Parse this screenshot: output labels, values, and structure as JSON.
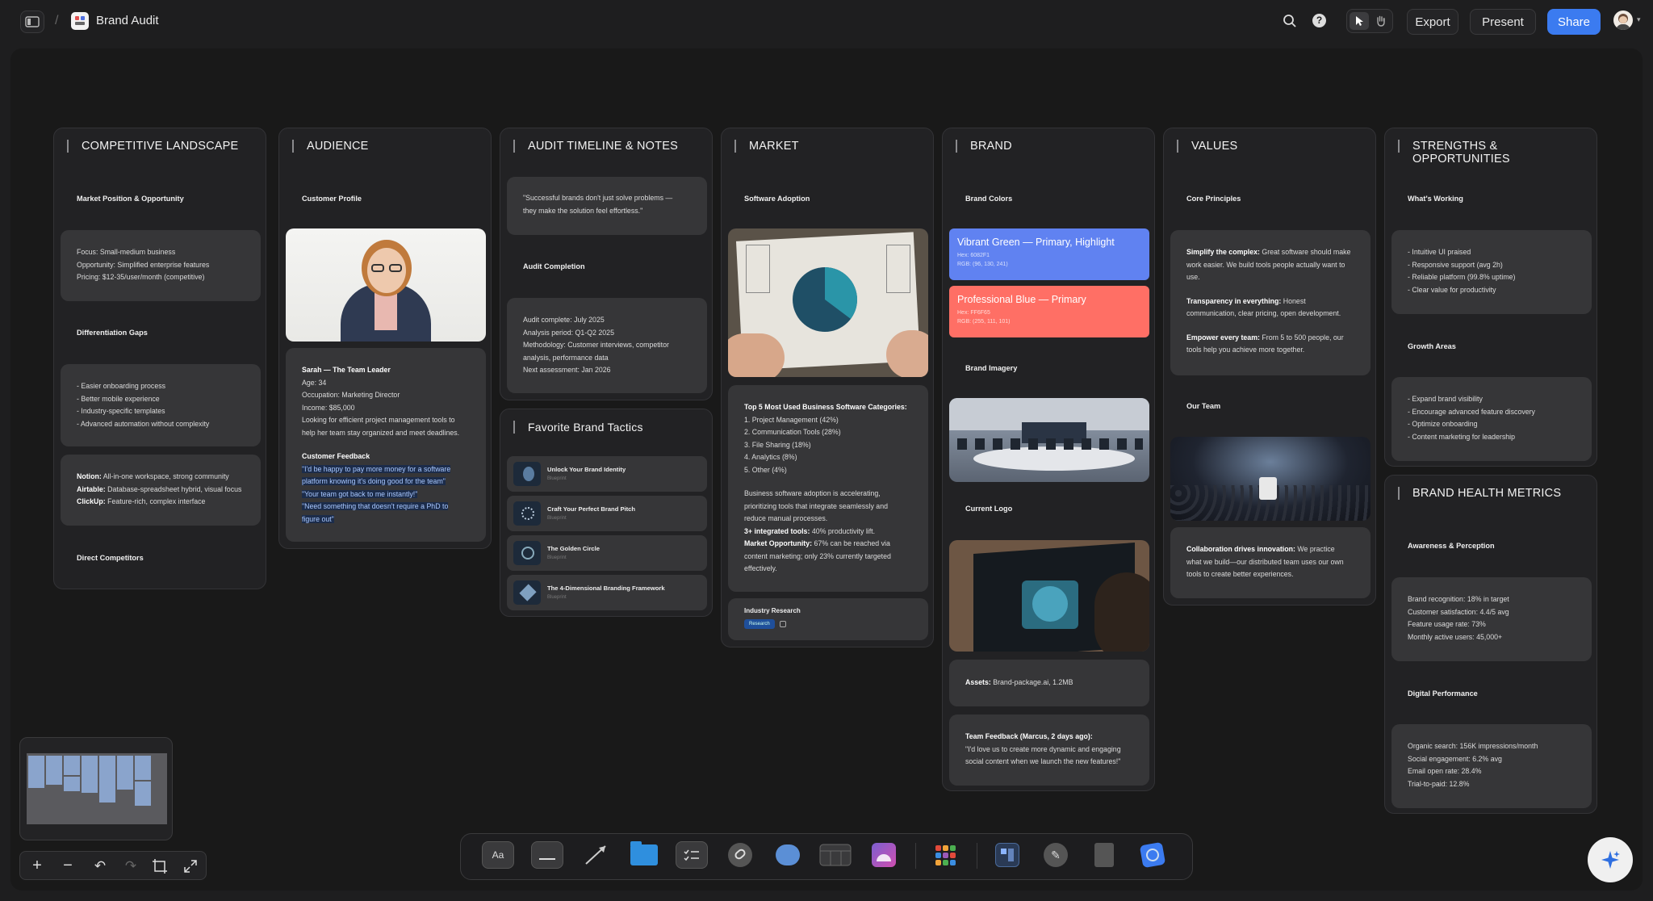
{
  "app": {
    "title": "Brand Audit",
    "breadcrumb_sep": "/"
  },
  "toolbar": {
    "export": "Export",
    "present": "Present",
    "share": "Share",
    "accent": "#3b7bf0"
  },
  "competitive": {
    "title": "COMPETITIVE LANDSCAPE",
    "market_label": "Market Position & Opportunity",
    "market_lines": [
      "Focus: Small-medium business",
      "Opportunity: Simplified enterprise features",
      "Pricing: $12-35/user/month (competitive)"
    ],
    "gaps_label": "Differentiation Gaps",
    "gaps_lines": [
      "- Easier onboarding process",
      "- Better mobile experience",
      "- Industry-specific templates",
      "- Advanced automation without complexity"
    ],
    "competitors": [
      {
        "name": "Notion:",
        "desc": " All-in-one workspace, strong community"
      },
      {
        "name": "Airtable:",
        "desc": " Database-spreadsheet hybrid, visual focus"
      },
      {
        "name": "ClickUp:",
        "desc": " Feature-rich, complex interface"
      }
    ],
    "direct_label": "Direct Competitors"
  },
  "audience": {
    "title": "AUDIENCE",
    "profile_label": "Customer Profile",
    "persona_name": "Sarah — The Team Leader",
    "persona_lines": [
      "Age: 34",
      "Occupation: Marketing Director",
      "Income: $85,000",
      "Looking for efficient project management tools to",
      "help her team stay organized and meet deadlines."
    ],
    "feedback_label": "Customer Feedback",
    "feedback_lines": [
      "\"I'd be happy to pay more money for a software",
      "platform knowing it's doing good for the team\"",
      "\"Your team got back to me instantly!\"",
      "\"Need something that doesn't require a PhD to",
      "figure out\""
    ]
  },
  "timeline": {
    "title": "AUDIT TIMELINE & NOTES",
    "quote_lines": [
      "\"Successful brands don't just solve problems —",
      "they make the solution feel effortless.\""
    ],
    "completion_label": "Audit Completion",
    "completion_lines": [
      "Audit complete: July 2025",
      "Analysis period: Q1-Q2 2025",
      "Methodology: Customer interviews, competitor",
      "analysis, performance data",
      "Next assessment: Jan 2026"
    ],
    "tactics_title": "Favorite Brand Tactics",
    "tactics": [
      {
        "title": "Unlock Your Brand Identity",
        "sub": "Blueprint"
      },
      {
        "title": "Craft Your Perfect Brand Pitch",
        "sub": "Blueprint"
      },
      {
        "title": "The Golden Circle",
        "sub": "Blueprint"
      },
      {
        "title": "The 4-Dimensional Branding Framework",
        "sub": "Blueprint"
      }
    ]
  },
  "market": {
    "title": "MARKET",
    "adoption_label": "Software Adoption",
    "top5_title": "Top 5 Most Used Business Software Categories:",
    "top5": [
      "1. Project Management (42%)",
      "2. Communication Tools (28%)",
      "3. File Sharing (18%)",
      "4. Analytics (8%)",
      "5. Other (4%)"
    ],
    "para_lines": [
      "Business software adoption is accelerating,",
      "prioritizing tools that integrate seamlessly and",
      "reduce manual processes."
    ],
    "integrated_bold": "3+ integrated tools:",
    "integrated_rest": " 40% productivity lift.",
    "opp_bold": "Market Opportunity:",
    "opp_rest": " 67% can be reached via",
    "opp_lines": [
      "content marketing; only 23% currently targeted",
      "effectively."
    ],
    "research_label": "Industry Research",
    "research_tag": "Research"
  },
  "brand": {
    "title": "BRAND",
    "colors_label": "Brand Colors",
    "swatches": [
      {
        "name": "Vibrant Green — Primary, Highlight",
        "hex": "Hex: 6082F1",
        "rgb": "RGB: (96, 130, 241)",
        "color": "#6082f1"
      },
      {
        "name": "Professional Blue — Primary",
        "hex": "Hex: FF6F65",
        "rgb": "RGB: (255, 111, 101)",
        "color": "#ff6f65"
      }
    ],
    "imagery_label": "Brand Imagery",
    "logo_label": "Current Logo",
    "assets_bold": "Assets:",
    "assets_rest": " Brand-package.ai, 1.2MB",
    "feedback_bold": "Team Feedback (Marcus, 2 days ago):",
    "feedback_lines": [
      "\"I'd love us to create more dynamic and engaging",
      "social content when we launch the new features!\""
    ]
  },
  "values": {
    "title": "VALUES",
    "principles_label": "Core Principles",
    "p1_bold": "Simplify the complex:",
    "p1_rest": " Great software should make",
    "p1_lines": [
      "work easier. We build tools people actually want to",
      "use."
    ],
    "p2_bold": "Transparency in everything:",
    "p2_rest": " Honest",
    "p2_lines": [
      "communication, clear pricing, open development."
    ],
    "p3_bold": "Empower every team:",
    "p3_rest": " From 5 to 500 people, our",
    "p3_lines": [
      "tools help you achieve more together."
    ],
    "team_label": "Our Team",
    "collab_bold": "Collaboration drives innovation:",
    "collab_rest": " We practice",
    "collab_lines": [
      "what we build—our distributed team uses our own",
      "tools to create better experiences."
    ]
  },
  "strengths": {
    "title": "STRENGTHS & OPPORTUNITIES",
    "working_label": "What's Working",
    "working_lines": [
      "- Intuitive UI praised",
      "- Responsive support (avg 2h)",
      "- Reliable platform (99.8% uptime)",
      "- Clear value for productivity"
    ],
    "growth_label": "Growth Areas",
    "growth_lines": [
      "- Expand brand visibility",
      "- Encourage advanced feature discovery",
      "- Optimize onboarding",
      "- Content marketing for leadership"
    ]
  },
  "health": {
    "title": "BRAND HEALTH METRICS",
    "awareness_label": "Awareness & Perception",
    "awareness_lines": [
      "Brand recognition: 18% in target",
      "Customer satisfaction: 4.4/5 avg",
      "Feature usage rate: 73%",
      "Monthly active users: 45,000+"
    ],
    "digital_label": "Digital Performance",
    "digital_lines": [
      "Organic search: 156K impressions/month",
      "Social engagement: 6.2% avg",
      "Email open rate: 28.4%",
      "Trial-to-paid: 12.8%"
    ]
  },
  "dock": {
    "text_tool": "Aa"
  }
}
